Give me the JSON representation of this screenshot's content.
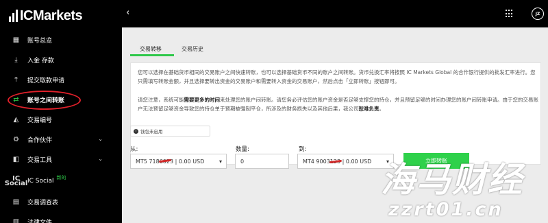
{
  "brand": {
    "logo_text": "ICMarkets"
  },
  "sidebar": {
    "items": [
      {
        "icon": "dashboard-icon",
        "label": "账号总览"
      },
      {
        "icon": "deposit-icon",
        "label": "入金 存款"
      },
      {
        "icon": "withdraw-icon",
        "label": "提交取款申请"
      },
      {
        "icon": "transfer-icon",
        "label": "账号之间转账",
        "active": true
      },
      {
        "icon": "trade-id-icon",
        "label": "交易编号"
      },
      {
        "icon": "partner-icon",
        "label": "合作伙伴",
        "expandable": true
      },
      {
        "icon": "tools-icon",
        "label": "交易工具",
        "expandable": true
      },
      {
        "icon": "ic-social-icon",
        "label": "IC Social",
        "badge": "新的",
        "icon_text": "IC Social"
      },
      {
        "icon": "survey-icon",
        "label": "交易调查表"
      },
      {
        "icon": "legal-icon",
        "label": "法律文件"
      }
    ]
  },
  "topbar": {
    "back_icon": "‹",
    "avatar_text": "JZ"
  },
  "tabs": [
    {
      "label": "交易转移",
      "active": true
    },
    {
      "label": "交易历史",
      "active": false
    }
  ],
  "info": {
    "paragraph1": "您可以选择在基础货币相同的交易账户之间快速转账，也可以选择基础货币不同的账户之间转账。货币兑换汇率将按照 IC Markets Global 的合作银行提供的批发汇率进行。您只需填写转账金额，并且选择要转出资金的交易账户和需要转入资金的交易账户，然后点击「立即转账」按钮即可。",
    "paragraph2_a": "请您注意，系统可能",
    "paragraph2_bold": "需要更多的时间",
    "paragraph2_b": "来处理您的账户间转账。请您务必评估您的账户资金是否足够支撑您的持仓，并且预留足够的时间办理您的账户间转账申请。由于您的交易账户无法预留足够资金导致您的持仓单于预期被强制平仓，所涉及的财务损失以及其他后果，我公司",
    "paragraph2_bold2": "恕难负责",
    "paragraph2_c": "。",
    "wallet_note": "钱包未启用"
  },
  "form": {
    "from_label": "从:",
    "from_value": "MT5 7186023 | 0.00 USD",
    "amount_label": "数量:",
    "amount_value": "0",
    "to_label": "到:",
    "to_value": "MT4 9003123 | 0.00 USD",
    "submit_label": "立即转账"
  },
  "watermark": {
    "line1": "海马财经",
    "line2": "zzrt01.cn"
  },
  "colors": {
    "accent": "#2fd14b",
    "highlight": "#e0202a",
    "sidebar_bg": "#000000",
    "content_bg": "#ececec"
  }
}
